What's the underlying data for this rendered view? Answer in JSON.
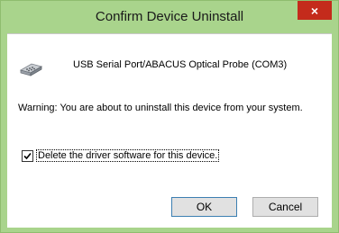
{
  "window": {
    "title": "Confirm Device Uninstall",
    "close_label": "×"
  },
  "device": {
    "icon": "usb-serial-port-icon",
    "name": "USB Serial Port/ABACUS Optical Probe (COM3)"
  },
  "warning_text": "Warning: You are about to uninstall this device from your system.",
  "delete_driver": {
    "label": "Delete the driver software for this device.",
    "checked": true
  },
  "buttons": {
    "ok_label": "OK",
    "cancel_label": "Cancel"
  },
  "colors": {
    "frame": "#a9d48c",
    "close": "#c42b1c"
  }
}
